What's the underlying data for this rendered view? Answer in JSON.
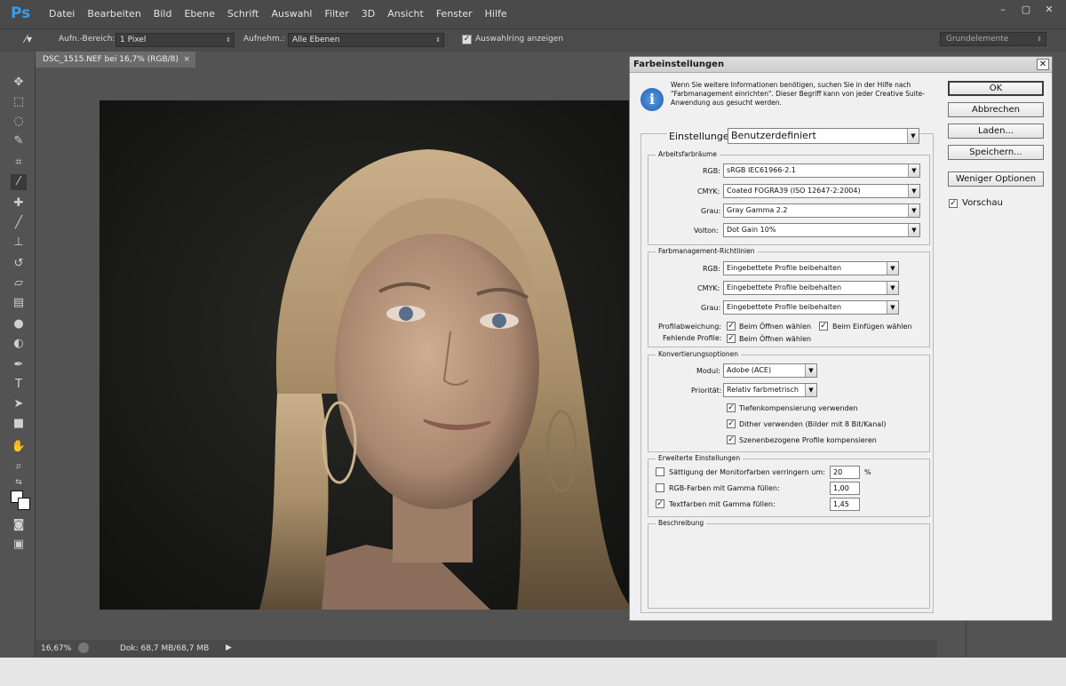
{
  "menubar": {
    "logo": "Ps",
    "items": [
      "Datei",
      "Bearbeiten",
      "Bild",
      "Ebene",
      "Schrift",
      "Auswahl",
      "Filter",
      "3D",
      "Ansicht",
      "Fenster",
      "Hilfe"
    ],
    "window_controls": [
      "–",
      "▢",
      "✕"
    ]
  },
  "options": {
    "sample_label": "Aufn.-Bereich:",
    "sample_value": "1 Pixel",
    "layers_label": "Aufnehm.:",
    "layers_value": "Alle Ebenen",
    "show_ring_label": "Auswahlring anzeigen",
    "show_ring_checked": true,
    "workspace": "Grundelemente"
  },
  "document": {
    "tab_title": "DSC_1515.NEF bei 16,7% (RGB/8)",
    "zoom": "16,67%",
    "doc_size": "Dok: 68,7 MB/68,7 MB"
  },
  "dialog": {
    "title": "Farbeinstellungen",
    "info": "Wenn Sie weitere Informationen benötigen, suchen Sie in der Hilfe nach \"Farbmanagement einrichten\". Dieser Begriff kann von jeder Creative Suite-Anwendung aus gesucht werden.",
    "buttons": {
      "ok": "OK",
      "cancel": "Abbrechen",
      "load": "Laden...",
      "save": "Speichern...",
      "fewer": "Weniger Optionen"
    },
    "preview_label": "Vorschau",
    "preview_checked": true,
    "settings_label": "Einstellungen:",
    "settings_value": "Benutzerdefiniert",
    "workspaces": {
      "title": "Arbeitsfarbräume",
      "rgb_label": "RGB:",
      "rgb": "sRGB IEC61966-2.1",
      "cmyk_label": "CMYK:",
      "cmyk": "Coated FOGRA39 (ISO 12647-2:2004)",
      "gray_label": "Grau:",
      "gray": "Gray Gamma 2.2",
      "spot_label": "Volton:",
      "spot": "Dot Gain 10%"
    },
    "policies": {
      "title": "Farbmanagement-Richtlinien",
      "rgb_label": "RGB:",
      "rgb": "Eingebettete Profile beibehalten",
      "cmyk_label": "CMYK:",
      "cmyk": "Eingebettete Profile beibehalten",
      "gray_label": "Grau:",
      "gray": "Eingebettete Profile beibehalten",
      "mismatch_label": "Profilabweichung:",
      "missing_label": "Fehlende Profile:",
      "open_label": "Beim Öffnen wählen",
      "paste_label": "Beim Einfügen wählen",
      "missing_open_label": "Beim Öffnen wählen"
    },
    "conversion": {
      "title": "Konvertierungsoptionen",
      "engine_label": "Modul:",
      "engine": "Adobe (ACE)",
      "intent_label": "Priorität:",
      "intent": "Relativ farbmetrisch",
      "bpc_label": "Tiefenkompensierung verwenden",
      "dither_label": "Dither verwenden (Bilder mit 8 Bit/Kanal)",
      "scene_label": "Szenenbezogene Profile kompensieren"
    },
    "advanced": {
      "title": "Erweiterte Einstellungen",
      "desat_label": "Sättigung der Monitorfarben verringern um:",
      "desat_value": "20",
      "desat_unit": "%",
      "rgb_gamma_label": "RGB-Farben mit Gamma füllen:",
      "rgb_gamma_value": "1,00",
      "text_gamma_label": "Textfarben mit Gamma füllen:",
      "text_gamma_value": "1,45"
    },
    "description_title": "Beschreibung"
  }
}
